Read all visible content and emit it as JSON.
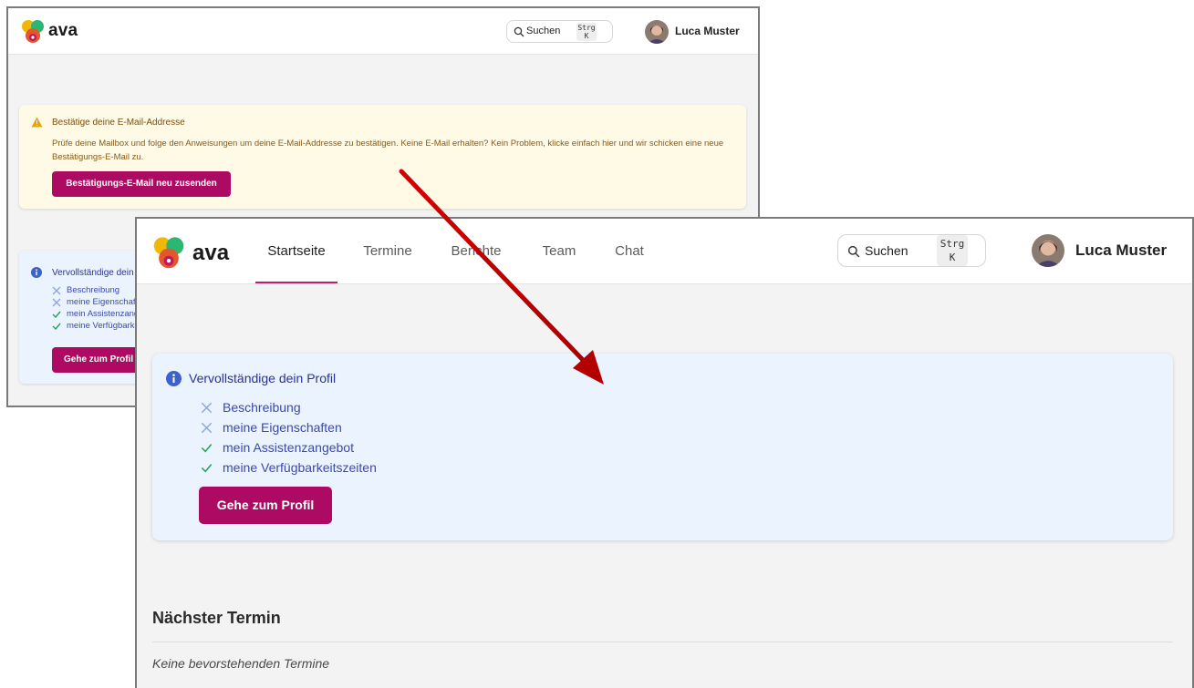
{
  "app": {
    "brand": "ava"
  },
  "colors": {
    "accent": "#ad0b63",
    "nav_active": "#c21b73",
    "arrow": "#c00000"
  },
  "search": {
    "label": "Suchen",
    "shortcut_line1": "Strg",
    "shortcut_line2": "K"
  },
  "user": {
    "name": "Luca Muster"
  },
  "nav": {
    "items": [
      {
        "label": "Startseite",
        "active": true
      },
      {
        "label": "Termine",
        "active": false
      },
      {
        "label": "Berichte",
        "active": false
      },
      {
        "label": "Team",
        "active": false
      },
      {
        "label": "Chat",
        "active": false
      }
    ]
  },
  "email_alert": {
    "title": "Bestätige deine E-Mail-Addresse",
    "text": "Prüfe deine Mailbox und folge den Anweisungen um deine E-Mail-Addresse zu bestätigen. Keine E-Mail erhalten? Kein Problem, klicke einfach hier und wir schicken eine neue Bestätigungs-E-Mail zu.",
    "button": "Bestätigungs-E-Mail neu zusenden"
  },
  "profile_alert": {
    "title": "Vervollständige dein Profil",
    "items": [
      {
        "label": "Beschreibung",
        "done": false
      },
      {
        "label": "meine Eigenschaften",
        "done": false
      },
      {
        "label": "mein Assistenzangebot",
        "done": true
      },
      {
        "label": "meine Verfügbarkeitszeiten",
        "done": true
      }
    ],
    "button": "Gehe zum Profil"
  },
  "next_appointment": {
    "title": "Nächster Termin",
    "empty": "Keine bevorstehenden Termine"
  },
  "icons": {
    "logo": "ava-logo-icon",
    "search": "search-icon",
    "warning": "warning-icon",
    "info": "info-icon",
    "cross": "cross-icon",
    "check": "check-icon"
  }
}
